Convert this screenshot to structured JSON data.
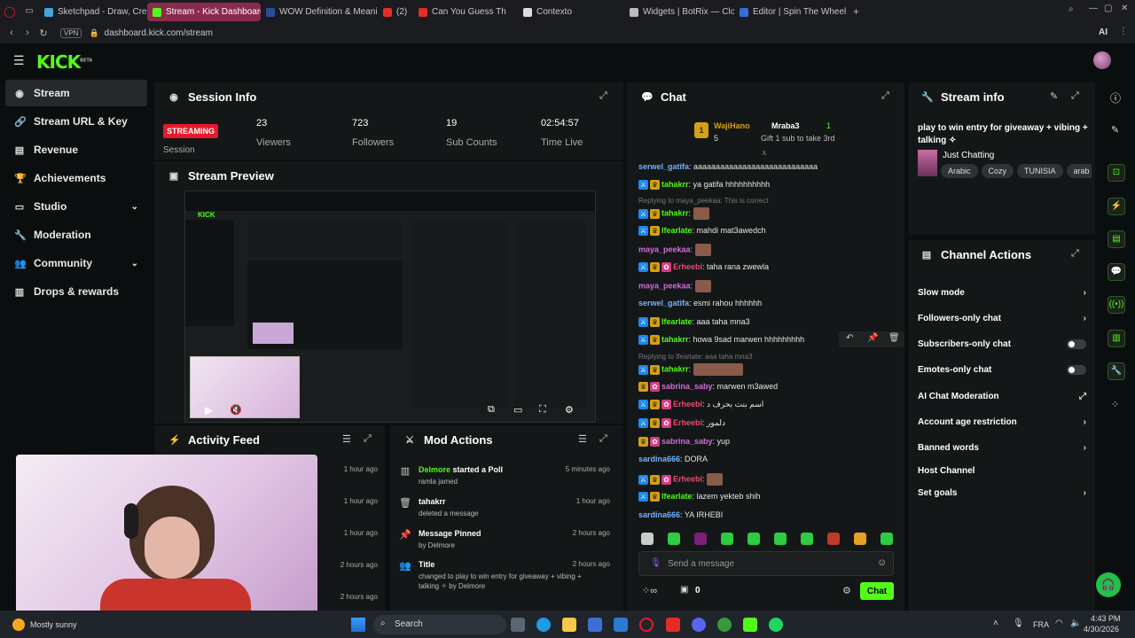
{
  "browser": {
    "tabs": [
      {
        "label": "Sketchpad - Draw, Create",
        "color": "#4aa3df"
      },
      {
        "label": "Stream - Kick Dashboard",
        "color": "#53fc18",
        "active": true
      },
      {
        "label": "WOW Definition & Meanin",
        "color": "#2a4d9b"
      },
      {
        "label": "(2)",
        "color": "#e52d27"
      },
      {
        "label": "Can You Guess Th",
        "color": "#e52d27"
      },
      {
        "label": "Contexto",
        "color": "#dddddd"
      },
      {
        "label": "Widgets | BotRix — Cloud",
        "color": "#bbbbbb"
      },
      {
        "label": "Editor | Spin The Wheel - ",
        "color": "#3c6bd6"
      }
    ],
    "url": "dashboard.kick.com/stream",
    "vpn": "VPN",
    "ai": "AI"
  },
  "header": {
    "logo": "KICK",
    "logo_sup": "BETA"
  },
  "sidebar": {
    "items": [
      {
        "label": "Stream",
        "icon": "◉"
      },
      {
        "label": "Stream URL & Key",
        "icon": "🔗"
      },
      {
        "label": "Revenue",
        "icon": "▤"
      },
      {
        "label": "Achievements",
        "icon": "🏆"
      },
      {
        "label": "Studio",
        "icon": "▭",
        "chevron": "⌄"
      },
      {
        "label": "Moderation",
        "icon": "🔧"
      },
      {
        "label": "Community",
        "icon": "👥",
        "chevron": "⌄"
      },
      {
        "label": "Drops & rewards",
        "icon": "▥"
      }
    ]
  },
  "session": {
    "title": "Session Info",
    "status": "STREAMING",
    "status_label": "Session",
    "viewers": "23",
    "viewers_label": "Viewers",
    "followers": "723",
    "followers_label": "Followers",
    "subs": "19",
    "subs_label": "Sub Counts",
    "time": "02:54:57",
    "time_label": "Time Live"
  },
  "preview": {
    "title": "Stream Preview"
  },
  "activity": {
    "title": "Activity Feed",
    "times": [
      "1 hour ago",
      "1 hour ago",
      "1 hour ago",
      "2 hours ago",
      "2 hours ago"
    ]
  },
  "mod": {
    "title": "Mod Actions",
    "rows": [
      {
        "user": "Delmore",
        "text": "started a Poll",
        "sub": "ramla jamed",
        "time": "5 minutes ago"
      },
      {
        "user": "tahakrr",
        "text": "",
        "sub": "deleted a message",
        "time": "1 hour ago"
      },
      {
        "user": "",
        "text": "Message Pinned",
        "sub": "by Delmore",
        "time": "2 hours ago"
      },
      {
        "user": "",
        "text": "Title",
        "sub": "changed to play to win entry for giveaway + vibing +",
        "sub2": "talking ✧ by Delmore",
        "time": "2 hours ago"
      }
    ]
  },
  "chat": {
    "title": "Chat",
    "top": {
      "user1": "WajiHano",
      "rank1": "1",
      "count1": "5",
      "user2": "Mraba3",
      "count2": "1",
      "gift": "Gift 1 sub to take 3rd"
    },
    "lines": [
      {
        "user": "serwel_gatifa",
        "color": "#6fb3ff",
        "text": ": aaaaaaaaaaaaaaaaaaaaaaaaaaaa",
        "badges": []
      },
      {
        "user": "tahakrr",
        "color": "#53fc18",
        "text": ": ya gatifa hhhhhhhhhh",
        "badges": [
          "blue",
          "gold"
        ]
      },
      {
        "reply": "Replying to maya_peekaa: This is correct"
      },
      {
        "user": "tahakrr",
        "color": "#53fc18",
        "text": ":",
        "badges": [
          "blue",
          "gold"
        ],
        "emote": true
      },
      {
        "user": "lfearlate",
        "color": "#53fc18",
        "text": ": mahdi mat3awedch",
        "badges": [
          "blue",
          "gold"
        ]
      },
      {
        "user": "maya_peekaa",
        "color": "#d36bd8",
        "text": ":",
        "badges": [],
        "emote": true
      },
      {
        "user": "Erheebi",
        "color": "#e84a6e",
        "text": ": taha rana zwewla",
        "badges": [
          "blue",
          "gold",
          "pink"
        ]
      },
      {
        "user": "maya_peekaa",
        "color": "#d36bd8",
        "text": ":",
        "badges": [],
        "emote": true
      },
      {
        "user": "serwel_gatifa",
        "color": "#6fb3ff",
        "text": ": esmi rahou hhhhhh",
        "badges": []
      },
      {
        "user": "lfearlate",
        "color": "#53fc18",
        "text": ": aaa taha mna3",
        "badges": [
          "blue",
          "gold"
        ]
      },
      {
        "user": "tahakrr",
        "color": "#53fc18",
        "text": ": howa 9sad marwen hhhhhhhhh",
        "badges": [
          "blue",
          "gold"
        ]
      },
      {
        "reply": "Replying to lfearlate: aaa taha mna3"
      },
      {
        "user": "tahakrr",
        "color": "#53fc18",
        "text": ":",
        "badges": [
          "blue",
          "gold"
        ],
        "emote": "wide"
      },
      {
        "user": "sabrina_saby",
        "color": "#d36bd8",
        "text": ": marwen m3awed",
        "badges": [
          "gold",
          "pink"
        ]
      },
      {
        "user": "Erheebi",
        "color": "#e84a6e",
        "text": ": اسم بنت بحرف د",
        "badges": [
          "blue",
          "gold",
          "pink"
        ]
      },
      {
        "user": "Erheebi",
        "color": "#e84a6e",
        "text": ": دلمور",
        "badges": [
          "blue",
          "gold",
          "pink"
        ]
      },
      {
        "user": "sabrina_saby",
        "color": "#d36bd8",
        "text": ": yup",
        "badges": [
          "gold",
          "pink"
        ]
      },
      {
        "user": "sardina666",
        "color": "#6fb3ff",
        "text": ": DORA",
        "badges": []
      },
      {
        "user": "Erheebi",
        "color": "#e84a6e",
        "text": ":",
        "badges": [
          "blue",
          "gold",
          "pink"
        ],
        "emote": true
      },
      {
        "user": "lfearlate",
        "color": "#53fc18",
        "text": ": lazem yekteb shih",
        "badges": [
          "blue",
          "gold"
        ]
      },
      {
        "user": "sardina666",
        "color": "#6fb3ff",
        "text": ": YA IRHEBI",
        "badges": []
      }
    ],
    "placeholder": "Send a message",
    "send": "Chat",
    "points": "0"
  },
  "stream_info": {
    "title": "Stream info",
    "stream_title": "play to win entry for giveaway + vibing + talking ✧",
    "category": "Just Chatting",
    "tags": [
      "Arabic",
      "Cozy",
      "TUNISIA",
      "arab"
    ]
  },
  "actions": {
    "title": "Channel Actions",
    "rows": [
      {
        "label": "Slow mode",
        "type": "chevron"
      },
      {
        "label": "Followers-only chat",
        "type": "chevron"
      },
      {
        "label": "Subscribers-only chat",
        "type": "toggle"
      },
      {
        "label": "Emotes-only chat",
        "type": "toggle"
      },
      {
        "label": "AI Chat Moderation",
        "type": "external"
      },
      {
        "label": "Account age restriction",
        "type": "chevron"
      },
      {
        "label": "Banned words",
        "type": "chevron"
      },
      {
        "label": "Host Channel",
        "type": "none"
      },
      {
        "label": "Set goals",
        "type": "chevron"
      }
    ]
  },
  "taskbar": {
    "weather": "Mostly sunny",
    "search": "Search",
    "lang": "FRA",
    "time": "4:43 PM",
    "date": "4/30/2026"
  },
  "colors": {
    "accent": "#53fc18",
    "panel": "#141718",
    "streaming": "#e5192b"
  }
}
